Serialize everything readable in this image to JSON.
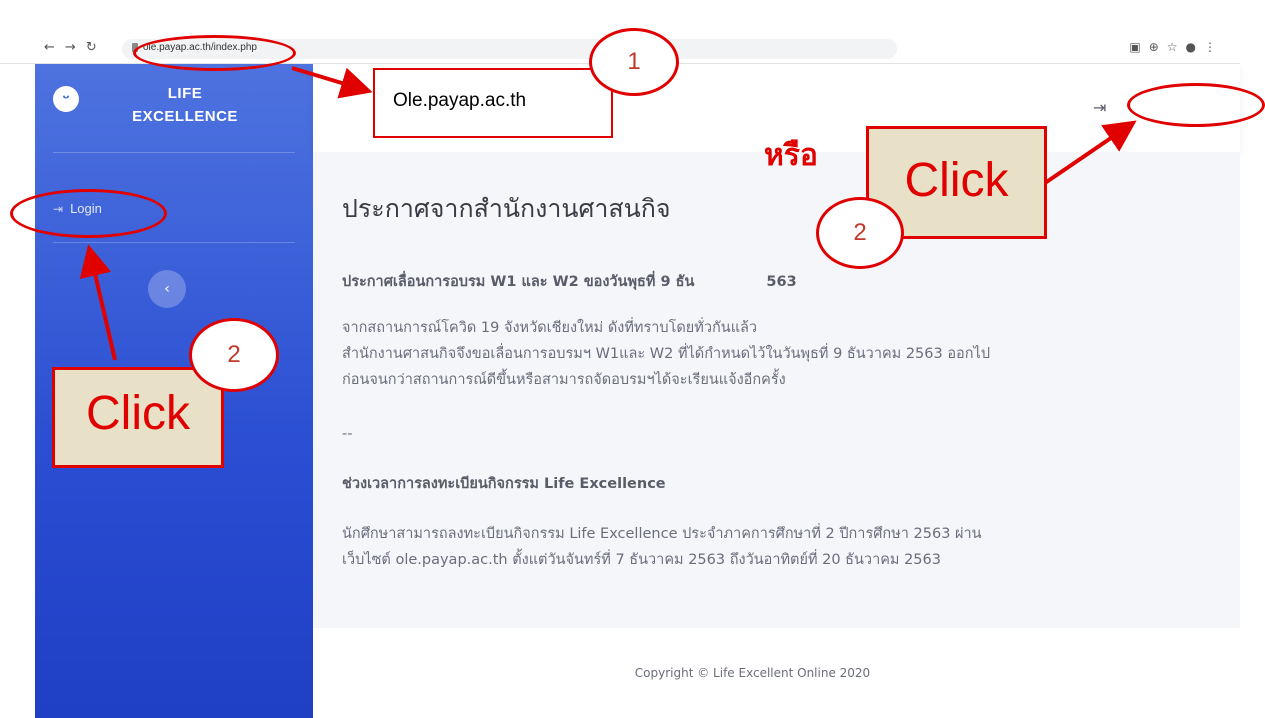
{
  "browser": {
    "url": "ole.payap.ac.th/index.php"
  },
  "sidebar": {
    "brand": "LIFE EXCELLENCE",
    "brand_line1": "LIFE",
    "brand_line2": "EXCELLENCE",
    "login_label": "Login",
    "toggle_icon": "‹"
  },
  "main": {
    "title": "ประกาศจากสำนักงานศาสนกิจ",
    "announcement1": {
      "heading": "ประกาศเลื่อนการอบรม W1 และ W2 ของวันพุธที่ 9 ธัน",
      "heading_tail": "563",
      "lines": [
        "จากสถานการณ์โควิด 19 จังหวัดเชียงใหม่ ดังที่ทราบโดยทั่วกันแล้ว",
        "สำนักงานศาสนกิจจึงขอเลื่อนการอบรมฯ W1และ W2 ที่ได้กำหนดไว้ในวันพุธที่ 9 ธันวาคม 2563 ออกไป",
        "ก่อนจนกว่าสถานการณ์ดีขึ้นหรือสามารถจัดอบรมฯได้จะเรียนแจ้งอีกครั้ง"
      ]
    },
    "separator": "--",
    "announcement2": {
      "heading": "ช่วงเวลาการลงทะเบียนกิจกรรม Life Excellence",
      "lines": [
        "นักศึกษาสามารถลงทะเบียนกิจกรรม Life Excellence ประจำภาคการศึกษาที่ 2 ปีการศึกษา 2563 ผ่าน",
        "เว็บไซต์ ole.payap.ac.th ตั้งแต่วันจันทร์ที่ 7 ธันวาคม 2563 ถึงวันอาทิตย์ที่ 20 ธันวาคม 2563"
      ]
    }
  },
  "footer": {
    "copyright": "Copyright © Life Excellent Online 2020"
  },
  "annotations": {
    "url_callout": "Ole.payap.ac.th",
    "or_text": "หรือ",
    "click_label": "Click",
    "step1": "1",
    "step2": "2"
  },
  "colors": {
    "sidebar_top": "#4e73df",
    "sidebar_bottom": "#1f3fc4",
    "annotation_red": "#e00000",
    "click_box_fill": "#e9e0c8"
  },
  "icons": {
    "back": "back-arrow-icon",
    "forward": "forward-arrow-icon",
    "reload": "reload-icon",
    "login": "sign-in-icon"
  }
}
